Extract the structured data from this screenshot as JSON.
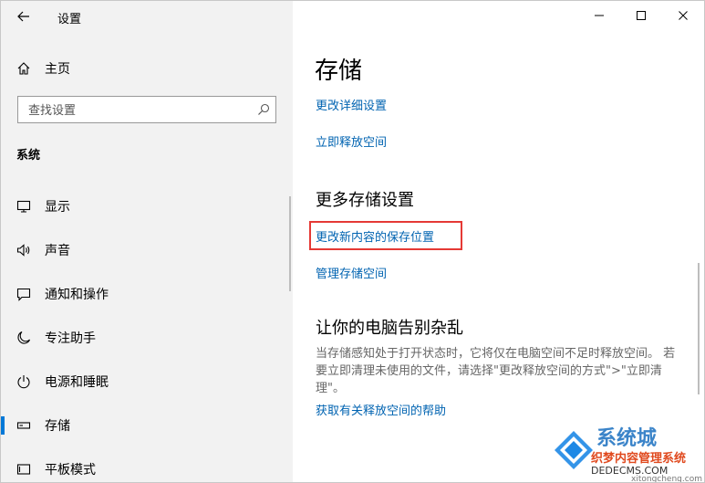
{
  "window": {
    "app_title": "设置",
    "controls": {
      "minimize": "minimize-icon",
      "maximize": "maximize-icon",
      "close": "close-icon"
    }
  },
  "sidebar": {
    "home_label": "主页",
    "search_placeholder": "查找设置",
    "section_label": "系统",
    "items": [
      {
        "label": "显示",
        "icon": "monitor-icon"
      },
      {
        "label": "声音",
        "icon": "speaker-icon"
      },
      {
        "label": "通知和操作",
        "icon": "notification-icon"
      },
      {
        "label": "专注助手",
        "icon": "moon-icon"
      },
      {
        "label": "电源和睡眠",
        "icon": "power-icon"
      },
      {
        "label": "存储",
        "icon": "storage-icon",
        "active": true
      },
      {
        "label": "平板模式",
        "icon": "tablet-icon"
      }
    ]
  },
  "main": {
    "title": "存储",
    "links_top": [
      "更改详细设置",
      "立即释放空间"
    ],
    "more_heading": "更多存储设置",
    "more_links": [
      "更改新内容的保存位置",
      "管理存储空间"
    ],
    "clutter_heading": "让你的电脑告别杂乱",
    "clutter_desc": "当存储感知处于打开状态时，它将仅在电脑空间不足时释放空间。 若要立即清理未使用的文件，请选择\"更改释放空间的方式\">\"立即清理\"。",
    "help_link": "获取有关释放空间的帮助"
  },
  "watermark": {
    "line1": "系统城",
    "line2": "织梦内容管理系统",
    "line3": "DEDECMS.COM",
    "line4": "xitongcheng.com"
  },
  "colors": {
    "accent": "#0078d7",
    "link": "#0063b1",
    "highlight": "#e53935"
  }
}
